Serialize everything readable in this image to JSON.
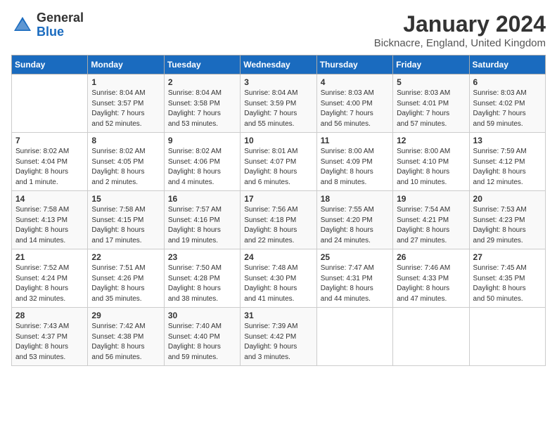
{
  "header": {
    "logo_general": "General",
    "logo_blue": "Blue",
    "month_title": "January 2024",
    "location": "Bicknacre, England, United Kingdom"
  },
  "days_of_week": [
    "Sunday",
    "Monday",
    "Tuesday",
    "Wednesday",
    "Thursday",
    "Friday",
    "Saturday"
  ],
  "weeks": [
    [
      {
        "day": "",
        "info": ""
      },
      {
        "day": "1",
        "info": "Sunrise: 8:04 AM\nSunset: 3:57 PM\nDaylight: 7 hours\nand 52 minutes."
      },
      {
        "day": "2",
        "info": "Sunrise: 8:04 AM\nSunset: 3:58 PM\nDaylight: 7 hours\nand 53 minutes."
      },
      {
        "day": "3",
        "info": "Sunrise: 8:04 AM\nSunset: 3:59 PM\nDaylight: 7 hours\nand 55 minutes."
      },
      {
        "day": "4",
        "info": "Sunrise: 8:03 AM\nSunset: 4:00 PM\nDaylight: 7 hours\nand 56 minutes."
      },
      {
        "day": "5",
        "info": "Sunrise: 8:03 AM\nSunset: 4:01 PM\nDaylight: 7 hours\nand 57 minutes."
      },
      {
        "day": "6",
        "info": "Sunrise: 8:03 AM\nSunset: 4:02 PM\nDaylight: 7 hours\nand 59 minutes."
      }
    ],
    [
      {
        "day": "7",
        "info": "Sunrise: 8:02 AM\nSunset: 4:04 PM\nDaylight: 8 hours\nand 1 minute."
      },
      {
        "day": "8",
        "info": "Sunrise: 8:02 AM\nSunset: 4:05 PM\nDaylight: 8 hours\nand 2 minutes."
      },
      {
        "day": "9",
        "info": "Sunrise: 8:02 AM\nSunset: 4:06 PM\nDaylight: 8 hours\nand 4 minutes."
      },
      {
        "day": "10",
        "info": "Sunrise: 8:01 AM\nSunset: 4:07 PM\nDaylight: 8 hours\nand 6 minutes."
      },
      {
        "day": "11",
        "info": "Sunrise: 8:00 AM\nSunset: 4:09 PM\nDaylight: 8 hours\nand 8 minutes."
      },
      {
        "day": "12",
        "info": "Sunrise: 8:00 AM\nSunset: 4:10 PM\nDaylight: 8 hours\nand 10 minutes."
      },
      {
        "day": "13",
        "info": "Sunrise: 7:59 AM\nSunset: 4:12 PM\nDaylight: 8 hours\nand 12 minutes."
      }
    ],
    [
      {
        "day": "14",
        "info": "Sunrise: 7:58 AM\nSunset: 4:13 PM\nDaylight: 8 hours\nand 14 minutes."
      },
      {
        "day": "15",
        "info": "Sunrise: 7:58 AM\nSunset: 4:15 PM\nDaylight: 8 hours\nand 17 minutes."
      },
      {
        "day": "16",
        "info": "Sunrise: 7:57 AM\nSunset: 4:16 PM\nDaylight: 8 hours\nand 19 minutes."
      },
      {
        "day": "17",
        "info": "Sunrise: 7:56 AM\nSunset: 4:18 PM\nDaylight: 8 hours\nand 22 minutes."
      },
      {
        "day": "18",
        "info": "Sunrise: 7:55 AM\nSunset: 4:20 PM\nDaylight: 8 hours\nand 24 minutes."
      },
      {
        "day": "19",
        "info": "Sunrise: 7:54 AM\nSunset: 4:21 PM\nDaylight: 8 hours\nand 27 minutes."
      },
      {
        "day": "20",
        "info": "Sunrise: 7:53 AM\nSunset: 4:23 PM\nDaylight: 8 hours\nand 29 minutes."
      }
    ],
    [
      {
        "day": "21",
        "info": "Sunrise: 7:52 AM\nSunset: 4:24 PM\nDaylight: 8 hours\nand 32 minutes."
      },
      {
        "day": "22",
        "info": "Sunrise: 7:51 AM\nSunset: 4:26 PM\nDaylight: 8 hours\nand 35 minutes."
      },
      {
        "day": "23",
        "info": "Sunrise: 7:50 AM\nSunset: 4:28 PM\nDaylight: 8 hours\nand 38 minutes."
      },
      {
        "day": "24",
        "info": "Sunrise: 7:48 AM\nSunset: 4:30 PM\nDaylight: 8 hours\nand 41 minutes."
      },
      {
        "day": "25",
        "info": "Sunrise: 7:47 AM\nSunset: 4:31 PM\nDaylight: 8 hours\nand 44 minutes."
      },
      {
        "day": "26",
        "info": "Sunrise: 7:46 AM\nSunset: 4:33 PM\nDaylight: 8 hours\nand 47 minutes."
      },
      {
        "day": "27",
        "info": "Sunrise: 7:45 AM\nSunset: 4:35 PM\nDaylight: 8 hours\nand 50 minutes."
      }
    ],
    [
      {
        "day": "28",
        "info": "Sunrise: 7:43 AM\nSunset: 4:37 PM\nDaylight: 8 hours\nand 53 minutes."
      },
      {
        "day": "29",
        "info": "Sunrise: 7:42 AM\nSunset: 4:38 PM\nDaylight: 8 hours\nand 56 minutes."
      },
      {
        "day": "30",
        "info": "Sunrise: 7:40 AM\nSunset: 4:40 PM\nDaylight: 8 hours\nand 59 minutes."
      },
      {
        "day": "31",
        "info": "Sunrise: 7:39 AM\nSunset: 4:42 PM\nDaylight: 9 hours\nand 3 minutes."
      },
      {
        "day": "",
        "info": ""
      },
      {
        "day": "",
        "info": ""
      },
      {
        "day": "",
        "info": ""
      }
    ]
  ]
}
